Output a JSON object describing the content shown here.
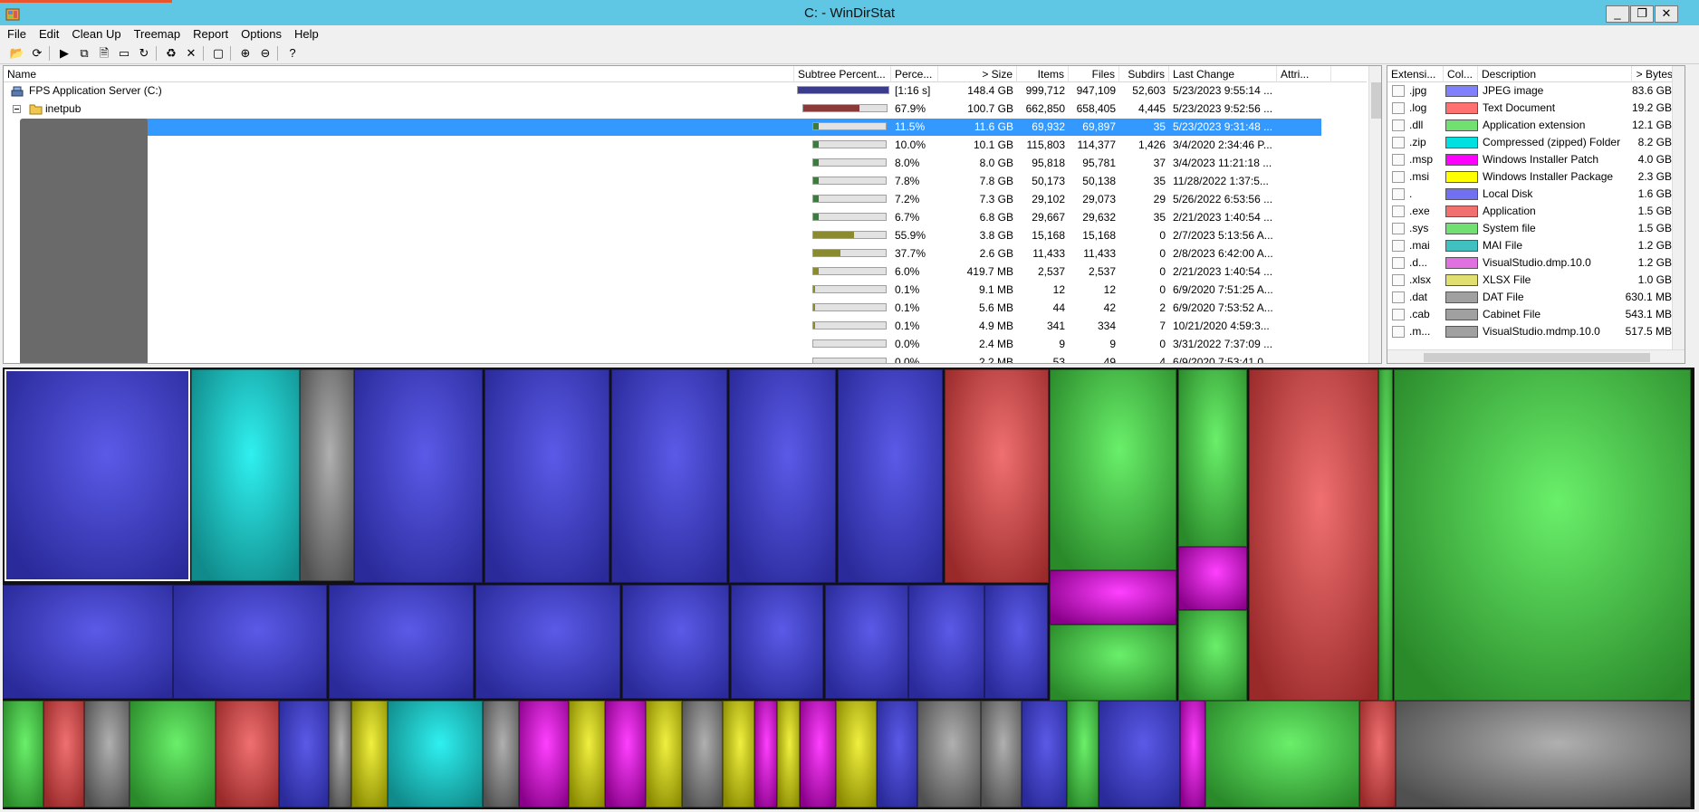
{
  "window": {
    "title": "C: - WinDirStat",
    "minimize": "_",
    "maximize": "❐",
    "close": "✕"
  },
  "menu": [
    "File",
    "Edit",
    "Clean Up",
    "Treemap",
    "Report",
    "Options",
    "Help"
  ],
  "toolbar": [
    {
      "name": "open-icon",
      "glyph": "📂"
    },
    {
      "name": "refresh-icon",
      "glyph": "⟳"
    },
    {
      "name": "play-icon",
      "glyph": "▶"
    },
    {
      "name": "copy-icon",
      "glyph": "⧉"
    },
    {
      "name": "explorer-icon",
      "glyph": "🗎"
    },
    {
      "name": "cmd-icon",
      "glyph": "▭"
    },
    {
      "name": "refresh-selected-icon",
      "glyph": "↻"
    },
    {
      "name": "recycle-icon",
      "glyph": "♻"
    },
    {
      "name": "delete-icon",
      "glyph": "✕"
    },
    {
      "name": "new-folder-icon",
      "glyph": "▢"
    },
    {
      "name": "zoom-in-icon",
      "glyph": "⊕"
    },
    {
      "name": "zoom-out-icon",
      "glyph": "⊖"
    },
    {
      "name": "help-icon",
      "glyph": "?"
    }
  ],
  "tree": {
    "columns": [
      "Name",
      "Subtree Percent...",
      "Perce...",
      "> Size",
      "Items",
      "Files",
      "Subdirs",
      "Last Change",
      "Attri..."
    ],
    "rows": [
      {
        "name": "FPS Application Server (C:)",
        "bar": 1.0,
        "bar_color": "#3c3c8c",
        "pct": "[1:16 s]",
        "size": "148.4 GB",
        "items": "999,712",
        "files": "947,109",
        "subdirs": "52,603",
        "last_change": "5/23/2023  9:55:14 ...",
        "kind": "drive"
      },
      {
        "name": "inetpub",
        "bar": 0.679,
        "bar_color": "#8b3a3a",
        "pct": "67.9%",
        "size": "100.7 GB",
        "items": "662,850",
        "files": "658,405",
        "subdirs": "4,445",
        "last_change": "5/23/2023  9:52:56 ...",
        "kind": "folder"
      },
      {
        "name": "",
        "bar": 0.115,
        "bar_color": "#3e7a3e",
        "pct": "11.5%",
        "size": "11.6 GB",
        "items": "69,932",
        "files": "69,897",
        "subdirs": "35",
        "last_change": "5/23/2023  9:31:48 ...",
        "selected": true
      },
      {
        "name": "",
        "bar": 0.1,
        "bar_color": "#3e7a3e",
        "pct": "10.0%",
        "size": "10.1 GB",
        "items": "115,803",
        "files": "114,377",
        "subdirs": "1,426",
        "last_change": "3/4/2020  2:34:46 P..."
      },
      {
        "name": "",
        "bar": 0.08,
        "bar_color": "#3e7a3e",
        "pct": "8.0%",
        "size": "8.0 GB",
        "items": "95,818",
        "files": "95,781",
        "subdirs": "37",
        "last_change": "3/4/2023  11:21:18 ..."
      },
      {
        "name": "",
        "bar": 0.078,
        "bar_color": "#3e7a3e",
        "pct": "7.8%",
        "size": "7.8 GB",
        "items": "50,173",
        "files": "50,138",
        "subdirs": "35",
        "last_change": "11/28/2022  1:37:5..."
      },
      {
        "name": "",
        "bar": 0.072,
        "bar_color": "#3e7a3e",
        "pct": "7.2%",
        "size": "7.3 GB",
        "items": "29,102",
        "files": "29,073",
        "subdirs": "29",
        "last_change": "5/26/2022  6:53:56 ..."
      },
      {
        "name": "",
        "bar": 0.067,
        "bar_color": "#3e7a3e",
        "pct": "6.7%",
        "size": "6.8 GB",
        "items": "29,667",
        "files": "29,632",
        "subdirs": "35",
        "last_change": "2/21/2023  1:40:54 ..."
      },
      {
        "name": "",
        "bar": 0.559,
        "bar_color": "#8a8a30",
        "pct": "55.9%",
        "size": "3.8 GB",
        "items": "15,168",
        "files": "15,168",
        "subdirs": "0",
        "last_change": "2/7/2023  5:13:56 A..."
      },
      {
        "name": "",
        "bar": 0.377,
        "bar_color": "#8a8a30",
        "pct": "37.7%",
        "size": "2.6 GB",
        "items": "11,433",
        "files": "11,433",
        "subdirs": "0",
        "last_change": "2/8/2023  6:42:00 A..."
      },
      {
        "name": "",
        "bar": 0.06,
        "bar_color": "#8a8a30",
        "pct": "6.0%",
        "size": "419.7 MB",
        "items": "2,537",
        "files": "2,537",
        "subdirs": "0",
        "last_change": "2/21/2023  1:40:54 ..."
      },
      {
        "name": "",
        "bar": 0.001,
        "bar_color": "#8a8a30",
        "pct": "0.1%",
        "size": "9.1 MB",
        "items": "12",
        "files": "12",
        "subdirs": "0",
        "last_change": "6/9/2020  7:51:25 A..."
      },
      {
        "name": "",
        "bar": 0.001,
        "bar_color": "#8a8a30",
        "pct": "0.1%",
        "size": "5.6 MB",
        "items": "44",
        "files": "42",
        "subdirs": "2",
        "last_change": "6/9/2020  7:53:52 A..."
      },
      {
        "name": "",
        "bar": 0.001,
        "bar_color": "#8a8a30",
        "pct": "0.1%",
        "size": "4.9 MB",
        "items": "341",
        "files": "334",
        "subdirs": "7",
        "last_change": "10/21/2020  4:59:3..."
      },
      {
        "name": "",
        "bar": 0.0,
        "bar_color": "#8a8a30",
        "pct": "0.0%",
        "size": "2.4 MB",
        "items": "9",
        "files": "9",
        "subdirs": "0",
        "last_change": "3/31/2022  7:37:09 ..."
      },
      {
        "name": "",
        "bar": 0.0,
        "bar_color": "#8a8a30",
        "pct": "0.0%",
        "size": "2.2 MB",
        "items": "53",
        "files": "49",
        "subdirs": "4",
        "last_change": "6/9/2020  7:53:41 0..."
      }
    ]
  },
  "extensions": {
    "columns": [
      "Extensi...",
      "Col...",
      "Description",
      "> Bytes"
    ],
    "rows": [
      {
        "ext": ".jpg",
        "color": "#8080ff",
        "desc": "JPEG image",
        "bytes": "83.6 GB"
      },
      {
        "ext": ".log",
        "color": "#ff7070",
        "desc": "Text Document",
        "bytes": "19.2 GB"
      },
      {
        "ext": ".dll",
        "color": "#70e070",
        "desc": "Application extension",
        "bytes": "12.1 GB"
      },
      {
        "ext": ".zip",
        "color": "#00e0e0",
        "desc": "Compressed (zipped) Folder",
        "bytes": "8.2 GB"
      },
      {
        "ext": ".msp",
        "color": "#ff00ff",
        "desc": "Windows Installer Patch",
        "bytes": "4.0 GB"
      },
      {
        "ext": ".msi",
        "color": "#ffff00",
        "desc": "Windows Installer Package",
        "bytes": "2.3 GB"
      },
      {
        "ext": ".",
        "color": "#7070f0",
        "desc": "Local Disk",
        "bytes": "1.6 GB"
      },
      {
        "ext": ".exe",
        "color": "#f07070",
        "desc": "Application",
        "bytes": "1.5 GB"
      },
      {
        "ext": ".sys",
        "color": "#70e070",
        "desc": "System file",
        "bytes": "1.5 GB"
      },
      {
        "ext": ".mai",
        "color": "#40c0c0",
        "desc": "MAI File",
        "bytes": "1.2 GB"
      },
      {
        "ext": ".d...",
        "color": "#e070e0",
        "desc": "VisualStudio.dmp.10.0",
        "bytes": "1.2 GB"
      },
      {
        "ext": ".xlsx",
        "color": "#e0e070",
        "desc": "XLSX File",
        "bytes": "1.0 GB"
      },
      {
        "ext": ".dat",
        "color": "#a0a0a0",
        "desc": "DAT File",
        "bytes": "630.1 MB"
      },
      {
        "ext": ".cab",
        "color": "#a0a0a0",
        "desc": "Cabinet File",
        "bytes": "543.1 MB"
      },
      {
        "ext": ".m...",
        "color": "#a0a0a0",
        "desc": "VisualStudio.mdmp.10.0",
        "bytes": "517.5 MB"
      }
    ]
  }
}
